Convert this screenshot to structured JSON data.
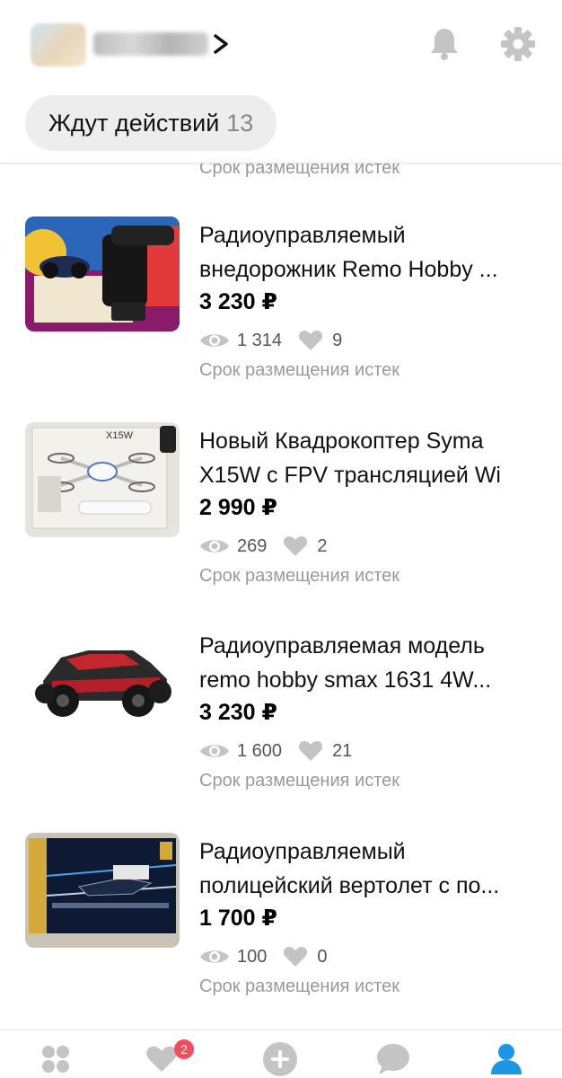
{
  "header": {
    "chip_label": "Ждут действий",
    "chip_count": "13"
  },
  "expired_label": "Срок размещения истек",
  "items": [
    {
      "title_line1": "Радиоуправляемый",
      "title_line2": "внедорожник Remo Hobby ...",
      "price": "3 230 ₽",
      "views": "1 314",
      "likes": "9",
      "status": "Срок размещения истек"
    },
    {
      "title_line1": "Новый Квадрокоптер Syma",
      "title_line2": "X15W с FPV трансляцией Wi",
      "price": "2 990 ₽",
      "views": "269",
      "likes": "2",
      "status": "Срок размещения истек"
    },
    {
      "title_line1": "Радиоуправляемая модель",
      "title_line2": "remo hobby smax 1631 4W...",
      "price": "3 230 ₽",
      "views": "1 600",
      "likes": "21",
      "status": "Срок размещения истек"
    },
    {
      "title_line1": "Радиоуправляемый",
      "title_line2": "полицейский вертолет с по...",
      "price": "1 700 ₽",
      "views": "100",
      "likes": "0",
      "status": "Срок размещения истек"
    }
  ],
  "bottom_nav": {
    "favorites_badge": "2",
    "tabs": [
      "home-icon",
      "heart-icon",
      "add-icon",
      "chat-icon",
      "profile-icon"
    ]
  },
  "colors": {
    "accent": "#1e96e8",
    "badge": "#f44b5d",
    "icon_gray": "#c4c4c4"
  }
}
